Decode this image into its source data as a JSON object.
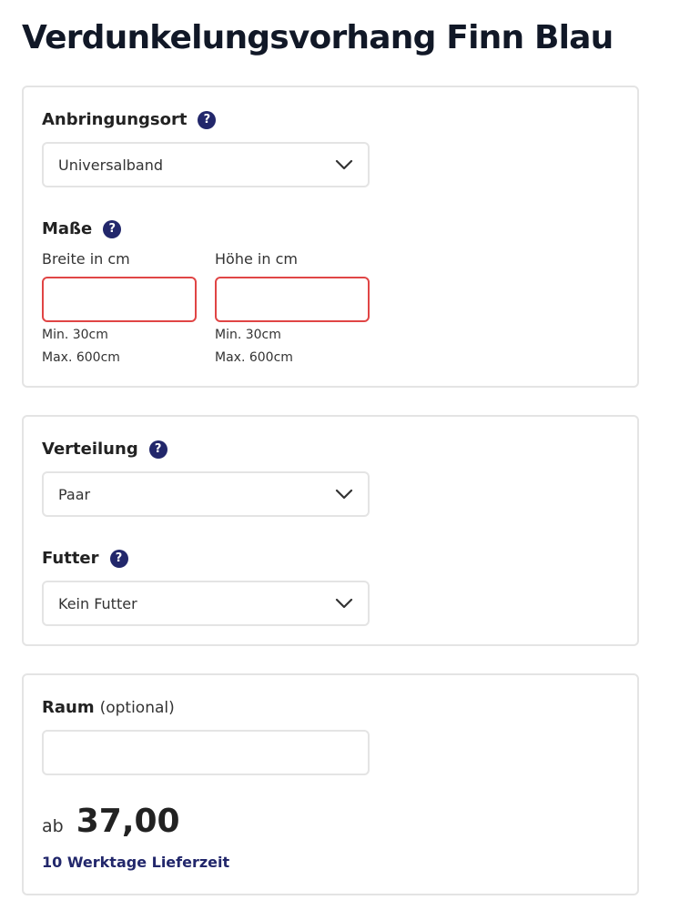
{
  "title": "Verdunkelungsvorhang Finn Blau",
  "help_glyph": "?",
  "anbringungsort": {
    "label": "Anbringungsort",
    "value": "Universalband"
  },
  "masse": {
    "label": "Maße",
    "breite": {
      "label": "Breite in cm",
      "value": "",
      "min": "Min. 30cm",
      "max": "Max. 600cm"
    },
    "hoehe": {
      "label": "Höhe in cm",
      "value": "",
      "min": "Min. 30cm",
      "max": "Max. 600cm"
    }
  },
  "verteilung": {
    "label": "Verteilung",
    "value": "Paar"
  },
  "futter": {
    "label": "Futter",
    "value": "Kein Futter"
  },
  "raum": {
    "label": "Raum",
    "optional": "(optional)",
    "value": ""
  },
  "price": {
    "prefix": "ab",
    "value": "37,00"
  },
  "delivery": "10 Werktage Lieferzeit",
  "colors": {
    "accent": "#22276b",
    "error_border": "#e04545",
    "border": "#e4e4e4"
  },
  "icons": {
    "help": "question-circle-icon",
    "dropdown": "chevron-down-icon"
  }
}
